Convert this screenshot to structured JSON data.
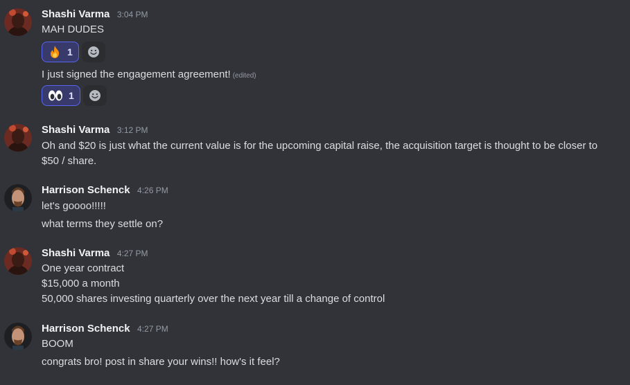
{
  "messages": [
    {
      "author": "Shashi Varma",
      "time": "3:04 PM",
      "lines": [
        {
          "text": "MAH DUDES",
          "reaction": {
            "emoji": "fire-emoji",
            "count": "1"
          }
        },
        {
          "text": "I just signed the engagement agreement!",
          "edited": "(edited)",
          "reaction": {
            "emoji": "eyes-emoji",
            "count": "1"
          }
        }
      ]
    },
    {
      "author": "Shashi Varma",
      "time": "3:12 PM",
      "lines": [
        {
          "text": "Oh and $20 is just what the current value is for the upcoming capital raise, the acquisition target is thought to be closer to"
        },
        {
          "text": "$50 / share."
        }
      ]
    },
    {
      "author": "Harrison Schenck",
      "time": "4:26 PM",
      "lines": [
        {
          "text": "let's goooo!!!!!"
        },
        {
          "text": "what terms they settle on?"
        }
      ]
    },
    {
      "author": "Shashi Varma",
      "time": "4:27 PM",
      "lines": [
        {
          "text": "One year contract"
        },
        {
          "text": "$15,000 a month"
        },
        {
          "text": "50,000 shares investing quarterly over the next year till a change of control"
        }
      ]
    },
    {
      "author": "Harrison Schenck",
      "time": "4:27 PM",
      "lines": [
        {
          "text": "BOOM"
        },
        {
          "text": "congrats bro! post in share your wins!! how's it feel?"
        }
      ]
    }
  ],
  "colors": {
    "background": "#313338",
    "reaction_active_bg": "#373a6b",
    "reaction_active_border": "#5865f2"
  },
  "icons": {
    "add_reaction": "smiley-icon"
  }
}
